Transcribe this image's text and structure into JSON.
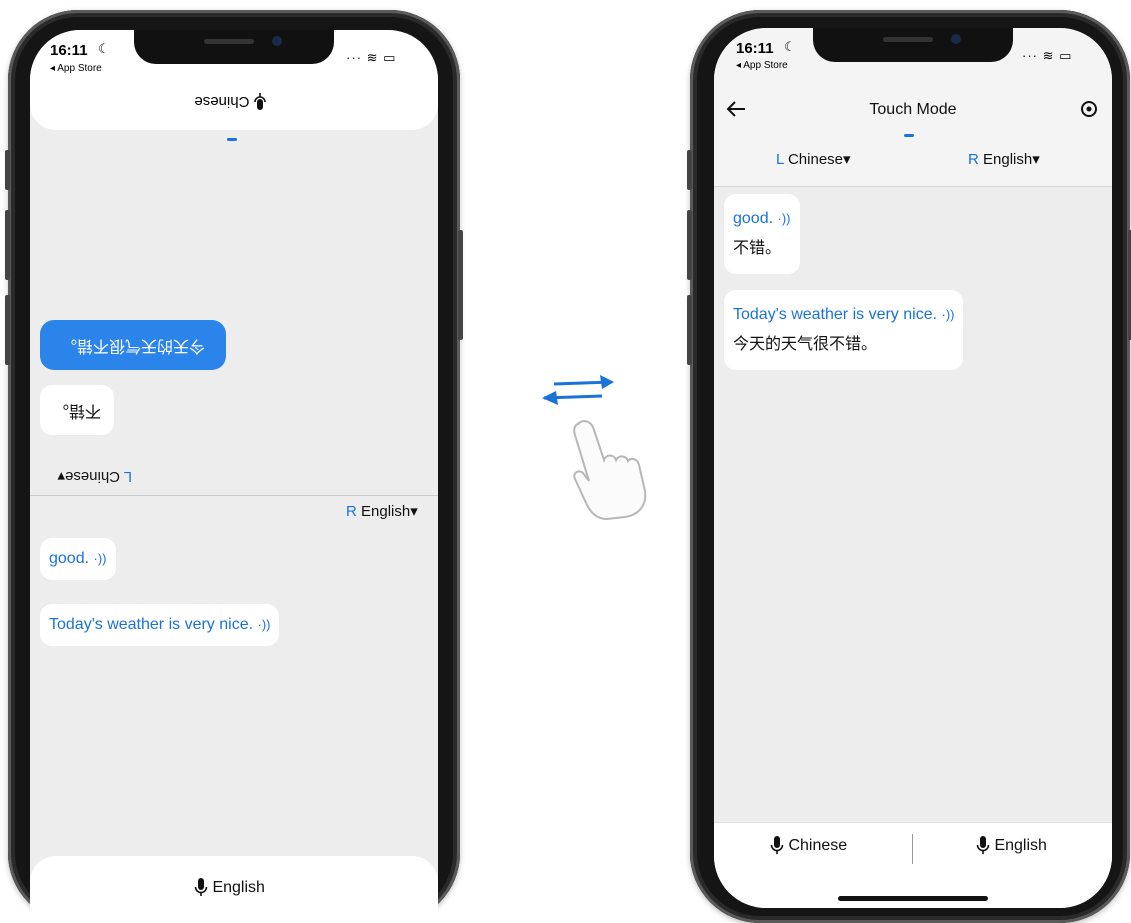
{
  "left_phone": {
    "status": {
      "time": "16:11",
      "back_app": "◂ App Store",
      "icons": "···  ≋  ▭"
    },
    "top_bar": {
      "language_label": "Chinese"
    },
    "flipped_messages": [
      {
        "text": "今天的天气很不错。",
        "style": "blue-bubble"
      },
      {
        "text": "不错。",
        "style": "white-bubble"
      }
    ],
    "top_language": {
      "tag": "L",
      "name": "Chinese"
    },
    "bottom_language": {
      "tag": "R",
      "name": "English"
    },
    "messages": [
      {
        "text": "good.",
        "audio_glyph": "·))"
      },
      {
        "text": "Today's weather is very nice.",
        "audio_glyph": "·))"
      }
    ],
    "bottom_button": {
      "label": "English"
    }
  },
  "swap_icon": {
    "name": "swap-arrows-icon",
    "pointer": "tap-hand-icon"
  },
  "right_phone": {
    "status": {
      "time": "16:11",
      "back_app": "◂ App Store",
      "icons": "···  ≋  ▭"
    },
    "header": {
      "title": "Touch Mode"
    },
    "languages": {
      "left": {
        "tag": "L",
        "name": "Chinese"
      },
      "right": {
        "tag": "R",
        "name": "English"
      }
    },
    "messages": [
      {
        "source": "good.",
        "translation": "不错。",
        "audio_glyph": "·))"
      },
      {
        "source": "Today's weather is very nice.",
        "translation": "今天的天气很不错。",
        "audio_glyph": "·))"
      }
    ],
    "bottom_buttons": {
      "left": "Chinese",
      "right": "English"
    }
  },
  "colors": {
    "accent": "#1a73d9",
    "screen_bg": "#ededee",
    "bubble_blue": "#2a84ea"
  }
}
